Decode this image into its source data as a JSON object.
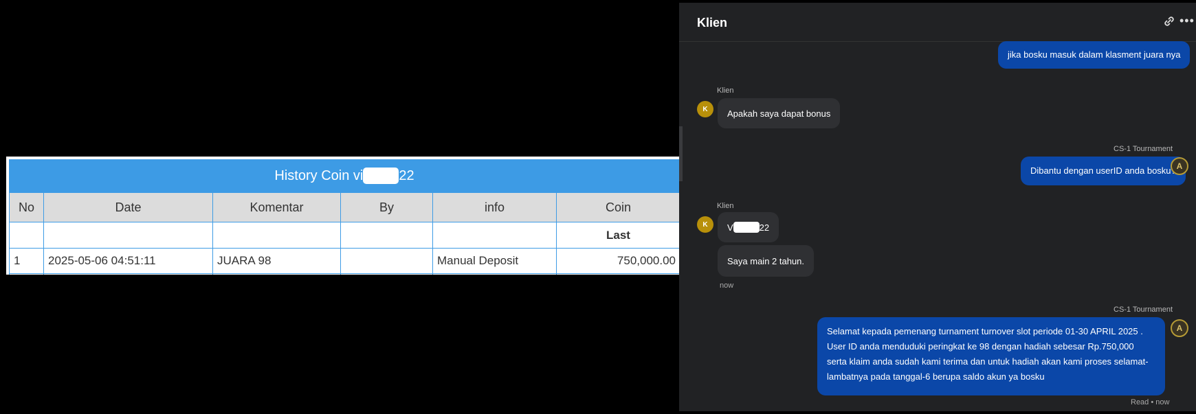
{
  "history": {
    "title_prefix": "History Coin vi",
    "title_suffix": "22",
    "columns": [
      "No",
      "Date",
      "Komentar",
      "By",
      "info",
      "Coin"
    ],
    "subheader": "Last",
    "rows": [
      {
        "no": "1",
        "date": "2025-05-06 04:51:11",
        "komentar": "JUARA 98",
        "by": "",
        "info": "Manual Deposit",
        "coin": "750,000.00"
      }
    ]
  },
  "chat": {
    "title": "Klien",
    "icons": {
      "link": "link-icon",
      "more": "more-icon"
    },
    "messages": {
      "m1": "jika bosku masuk dalam klasment juara nya",
      "m2_sender": "Klien",
      "m2": "Apakah saya dapat bonus",
      "m3_sender": "CS-1 Tournament",
      "m3": "Dibantu dengan userID anda bosku?",
      "m4_sender": "Klien",
      "m4_prefix": "V",
      "m4_suffix": "22",
      "m5": "Saya main 2 tahun.",
      "m5_time": "now",
      "m6_sender": "CS-1 Tournament",
      "m6": "Selamat kepada pemenang turnament turnover slot periode 01-30 APRIL 2025 . User ID anda menduduki peringkat ke 98 dengan hadiah sebesar Rp.750,000 serta klaim anda sudah kami terima dan untuk hadiah akan kami proses selamat-lambatnya pada tanggal-6 berupa saldo akun ya bosku",
      "m6_status": "Read • now"
    },
    "avatar_letter": "K"
  },
  "colors": {
    "header_blue": "#3d9be5",
    "bubble_blue": "#0b47a8",
    "coin_green": "#2a8a2a"
  }
}
